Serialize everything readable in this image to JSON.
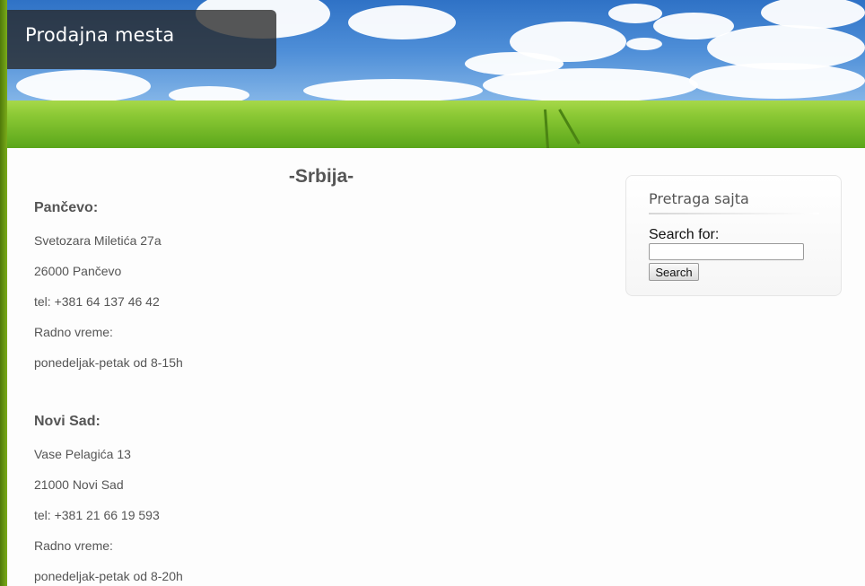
{
  "header": {
    "title": "Prodajna mesta"
  },
  "main": {
    "heading": "-Srbija-",
    "stores": [
      {
        "name": "Pančevo:",
        "street": "Svetozara Miletića 27a",
        "city": "26000 Pančevo",
        "phone": "tel: +381 64 137 46 42",
        "hours_label": "Radno vreme:",
        "hours": "ponedeljak-petak od 8-15h"
      },
      {
        "name": "Novi Sad:",
        "street": "Vase Pelagića 13",
        "city": "21000 Novi Sad",
        "phone": "tel: +381 21 66 19 593",
        "hours_label": "Radno vreme:",
        "hours": "ponedeljak-petak od 8-20h"
      }
    ]
  },
  "sidebar": {
    "search_widget": {
      "title": "Pretraga sajta",
      "label": "Search for:",
      "input_value": "",
      "button_label": "Search"
    }
  }
}
